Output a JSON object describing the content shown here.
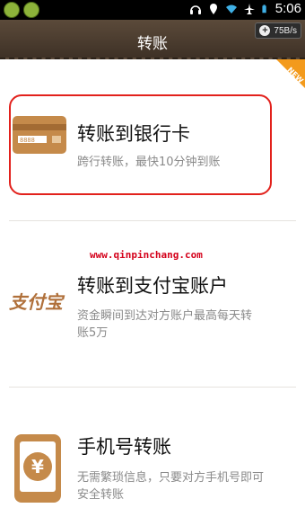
{
  "statusbar": {
    "time": "5:06",
    "speed": "75B/s"
  },
  "header": {
    "title": "转账"
  },
  "badge": {
    "new_label": "NEW"
  },
  "watermark": "www.qinpinchang.com",
  "items": [
    {
      "title": "转账到银行卡",
      "subtitle": "跨行转账，最快10分钟到账",
      "icon": "bank-card-icon"
    },
    {
      "title": "转账到支付宝账户",
      "subtitle_line1": "资金瞬间到达对方账户最高每天转",
      "subtitle_line2": "账5万",
      "icon": "alipay-logo",
      "logo_text": "支付宝"
    },
    {
      "title": "手机号转账",
      "subtitle_line1": "无需繁琐信息，只要对方手机号即可",
      "subtitle_line2": "安全转账",
      "icon": "phone-yuan-icon"
    }
  ],
  "colors": {
    "accent": "#c58a4a",
    "highlight": "#e2211c",
    "header": "#4a3b2e",
    "new_badge": "#f39a1c"
  }
}
